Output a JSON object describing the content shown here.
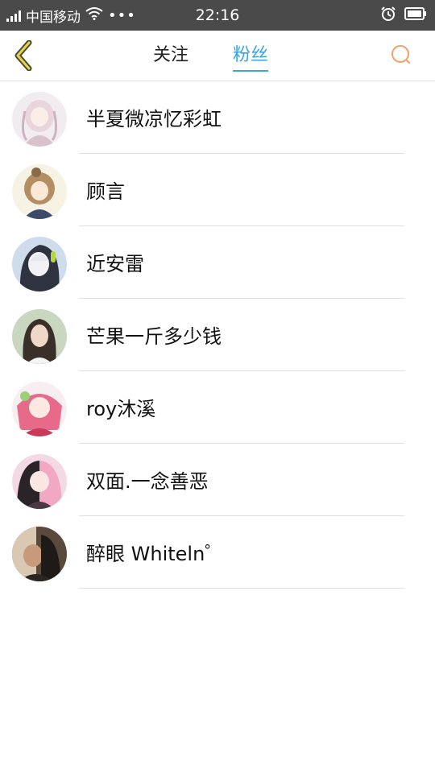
{
  "status_bar": {
    "carrier": "中国移动",
    "time": "22:16",
    "icons": [
      "signal-icon",
      "wifi-icon",
      "more-dots-icon",
      "alarm-icon",
      "battery-icon"
    ]
  },
  "header": {
    "back_icon": "chevron-left-icon",
    "tabs": [
      {
        "label": "关注",
        "active": false
      },
      {
        "label": "粉丝",
        "active": true
      }
    ],
    "search_icon": "search-icon",
    "active_color": "#3aa3e0",
    "accent_color": "#f0a06a"
  },
  "fans": [
    {
      "name": "半夏微凉忆彩虹"
    },
    {
      "name": "顾言"
    },
    {
      "name": "近安雷"
    },
    {
      "name": "芒果一斤多少钱"
    },
    {
      "name": "roy沐溪"
    },
    {
      "name": "双面.一念善恶"
    },
    {
      "name": "醉眼 Whiteln゜"
    }
  ]
}
